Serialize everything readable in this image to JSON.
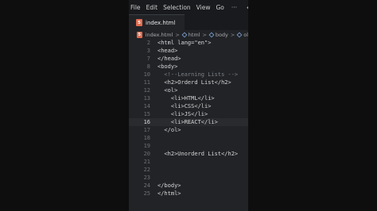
{
  "menu": {
    "file": "File",
    "edit": "Edit",
    "selection": "Selection",
    "view": "View",
    "go": "Go",
    "more": "···",
    "back": "←"
  },
  "tab": {
    "icon_text": "5",
    "title": "index.html"
  },
  "breadcrumb": {
    "file": "index.html",
    "sep": ">",
    "item1": "html",
    "item2": "body",
    "item3": "ol"
  },
  "code": {
    "lines": [
      {
        "n": "2",
        "text": "<html lang=\"en\">"
      },
      {
        "n": "3",
        "text": "<head>"
      },
      {
        "n": "7",
        "text": "</head>"
      },
      {
        "n": "8",
        "text": "<body>"
      },
      {
        "n": "10",
        "text": "  <!--Learning Lists -->"
      },
      {
        "n": "11",
        "text": "  <h2>Orderd List</h2>"
      },
      {
        "n": "12",
        "text": "  <ol>"
      },
      {
        "n": "13",
        "text": "    <li>HTML</li>"
      },
      {
        "n": "14",
        "text": "    <li>CSS</li>"
      },
      {
        "n": "15",
        "text": "    <li>JS</li>"
      },
      {
        "n": "16",
        "text": "    <li>REACT</li>"
      },
      {
        "n": "17",
        "text": "  </ol>"
      },
      {
        "n": "18",
        "text": ""
      },
      {
        "n": "19",
        "text": ""
      },
      {
        "n": "20",
        "text": "  <h2>Unorderd List</h2>"
      },
      {
        "n": "21",
        "text": ""
      },
      {
        "n": "22",
        "text": ""
      },
      {
        "n": "23",
        "text": ""
      },
      {
        "n": "24",
        "text": "</body>"
      },
      {
        "n": "25",
        "text": "</html>"
      }
    ],
    "active_line": "16"
  },
  "colors": {
    "editor_bg": "#212327",
    "tab_icon": "#e06c4f"
  }
}
